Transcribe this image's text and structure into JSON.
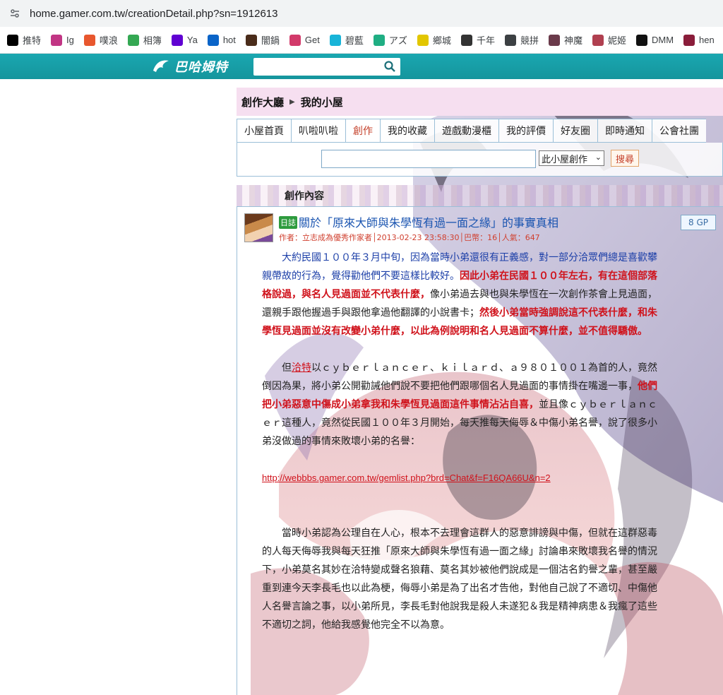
{
  "browser": {
    "url": "home.gamer.com.tw/creationDetail.php?sn=1912613",
    "bookmarks": [
      {
        "label": "推特",
        "icon": "x-icon",
        "color": "#000000"
      },
      {
        "label": "Ig",
        "icon": "instagram-icon",
        "color": "#c13584"
      },
      {
        "label": "噗浪",
        "icon": "plurk-icon",
        "color": "#e8572e"
      },
      {
        "label": "相簿",
        "icon": "photos-icon",
        "color": "#34a853"
      },
      {
        "label": "Ya",
        "icon": "yahoo-icon",
        "color": "#6001d2"
      },
      {
        "label": "hot",
        "icon": "outlook-icon",
        "color": "#0a64c8"
      },
      {
        "label": "闇鍋",
        "icon": "ring-icon",
        "color": "#4a2c1a"
      },
      {
        "label": "Get",
        "icon": "get-icon",
        "color": "#d23a6a"
      },
      {
        "label": "碧藍",
        "icon": "bilibili-icon",
        "color": "#18b4d8"
      },
      {
        "label": "アズ",
        "icon": "azure-icon",
        "color": "#1fae83"
      },
      {
        "label": "鄉城",
        "icon": "leaf-icon",
        "color": "#e2c600"
      },
      {
        "label": "千年",
        "icon": "sennen-icon",
        "color": "#333333"
      },
      {
        "label": "競拼",
        "icon": "globe-icon",
        "color": "#3c4043"
      },
      {
        "label": "神魔",
        "icon": "shenmo-icon",
        "color": "#6a3a4a"
      },
      {
        "label": "妮姬",
        "icon": "nikke-icon",
        "color": "#b04050"
      },
      {
        "label": "DMM",
        "icon": "dmm-icon",
        "color": "#111111"
      },
      {
        "label": "hen",
        "icon": "hen-icon",
        "color": "#8a1d3a"
      }
    ]
  },
  "site": {
    "logo_text": "巴哈姆特"
  },
  "breadcrumb": {
    "first": "創作大廳",
    "second": "我的小屋"
  },
  "tabs": [
    "小屋首頁",
    "叭啦叭啦",
    "創作",
    "我的收藏",
    "遊戲動漫櫃",
    "我的評價",
    "好友圈",
    "即時通知",
    "公會社團"
  ],
  "active_tab": 2,
  "search": {
    "select_value": "此小屋創作",
    "button": "搜尋"
  },
  "section_title": "創作內容",
  "post": {
    "badge": "日誌",
    "title": "關於「原來大師與朱學恆有過一面之緣」的事實真相",
    "gp": "8 GP",
    "meta": "作者：立志成為優秀作家者│2013-02-23 23:58:30│巴幣：16│人氣：647",
    "p1_blue": "大約民國１００年３月中旬，因為當時小弟還很有正義感，對一部分洽眾們總是喜歡攀親帶故的行為，覺得勸他們不要這樣比較好。",
    "p1_red1": "因此小弟在民國１００年左右，有在這個部落格說過，與名人見過面並不代表什麼，",
    "p1_normal": "像小弟過去與也與朱學恆在一次創作茶會上見過面，還親手跟他握過手與跟他拿過他翻譯的小說書卡；",
    "p1_red2": "然後小弟當時強調說這不代表什麼，和朱學恆見過面並沒有改變小弟什麼，以此為例說明和名人見過面不算什麼，並不值得驕傲。",
    "p2_a": "但",
    "p2_link": "洽特",
    "p2_b": "以ｃｙｂｅｒｌａｎｃｅｒ、ｋｉｌａｒｄ、ａ９８０１００１為首的人，竟然倒因為果，將小弟公開勸誡他們說不要把他們跟哪個名人見過面的事情掛在嘴邊一事，",
    "p2_red": "他們把小弟惡意中傷成小弟拿我和朱學恆見過面這件事情沾沾自喜，",
    "p2_c": "並且像ｃｙｂｅｒｌａｎｃｅｒ這種人，竟然從民國１００年３月開始，每天推每天侮辱＆中傷小弟名譽，說了很多小弟沒做過的事情來敗壞小弟的名譽：",
    "url_link": "http://webbbs.gamer.com.tw/gemlist.php?brd=Chat&f=F16QA66U&n=2",
    "p3": "當時小弟認為公理自在人心，根本不去理會這群人的惡意誹謗與中傷，但就在這群惡毒的人每天侮辱我與每天狂推「原來大師與朱學恆有過一面之緣」討論串來敗壞我名譽的情況下，小弟莫名其妙在洽特變成聲名狼藉、莫名其妙被他們說成是一個沽名釣譽之輩，甚至嚴重到連今天李長毛也以此為梗，侮辱小弟是為了出名才告他，對他自己說了不適切、中傷他人名譽言論之事，以小弟所見，李長毛對他說我是殺人未遂犯＆我是精神病患＆我瘋了這些不適切之詞，他給我感覺他完全不以為意。"
  }
}
